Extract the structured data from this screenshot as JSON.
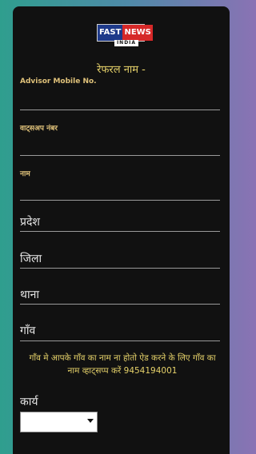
{
  "logo": {
    "fast": "FAST",
    "news": "NEWS",
    "india": "INDIA"
  },
  "form": {
    "referral_title": "रेफरल नाम -",
    "advisor_mobile_label": "Advisor Mobile No.",
    "whatsapp_label": "वाट्सअप नंबर",
    "name_label": "नाम",
    "state_label": "प्रदेश",
    "district_label": "जिला",
    "police_station_label": "थाना",
    "village_label": "गाँव",
    "village_notice": "गाँव मे आपके गाँव का नाम ना होतो ऐड करने के लिए गाँव का नाम व्हाट्सप्प करें 9454194001",
    "work_label": "कार्य",
    "work_select_value": ""
  },
  "colors": {
    "card_bg": "#111111",
    "accent_gold": "#e6d26a",
    "label_gold": "#e0c27a"
  }
}
